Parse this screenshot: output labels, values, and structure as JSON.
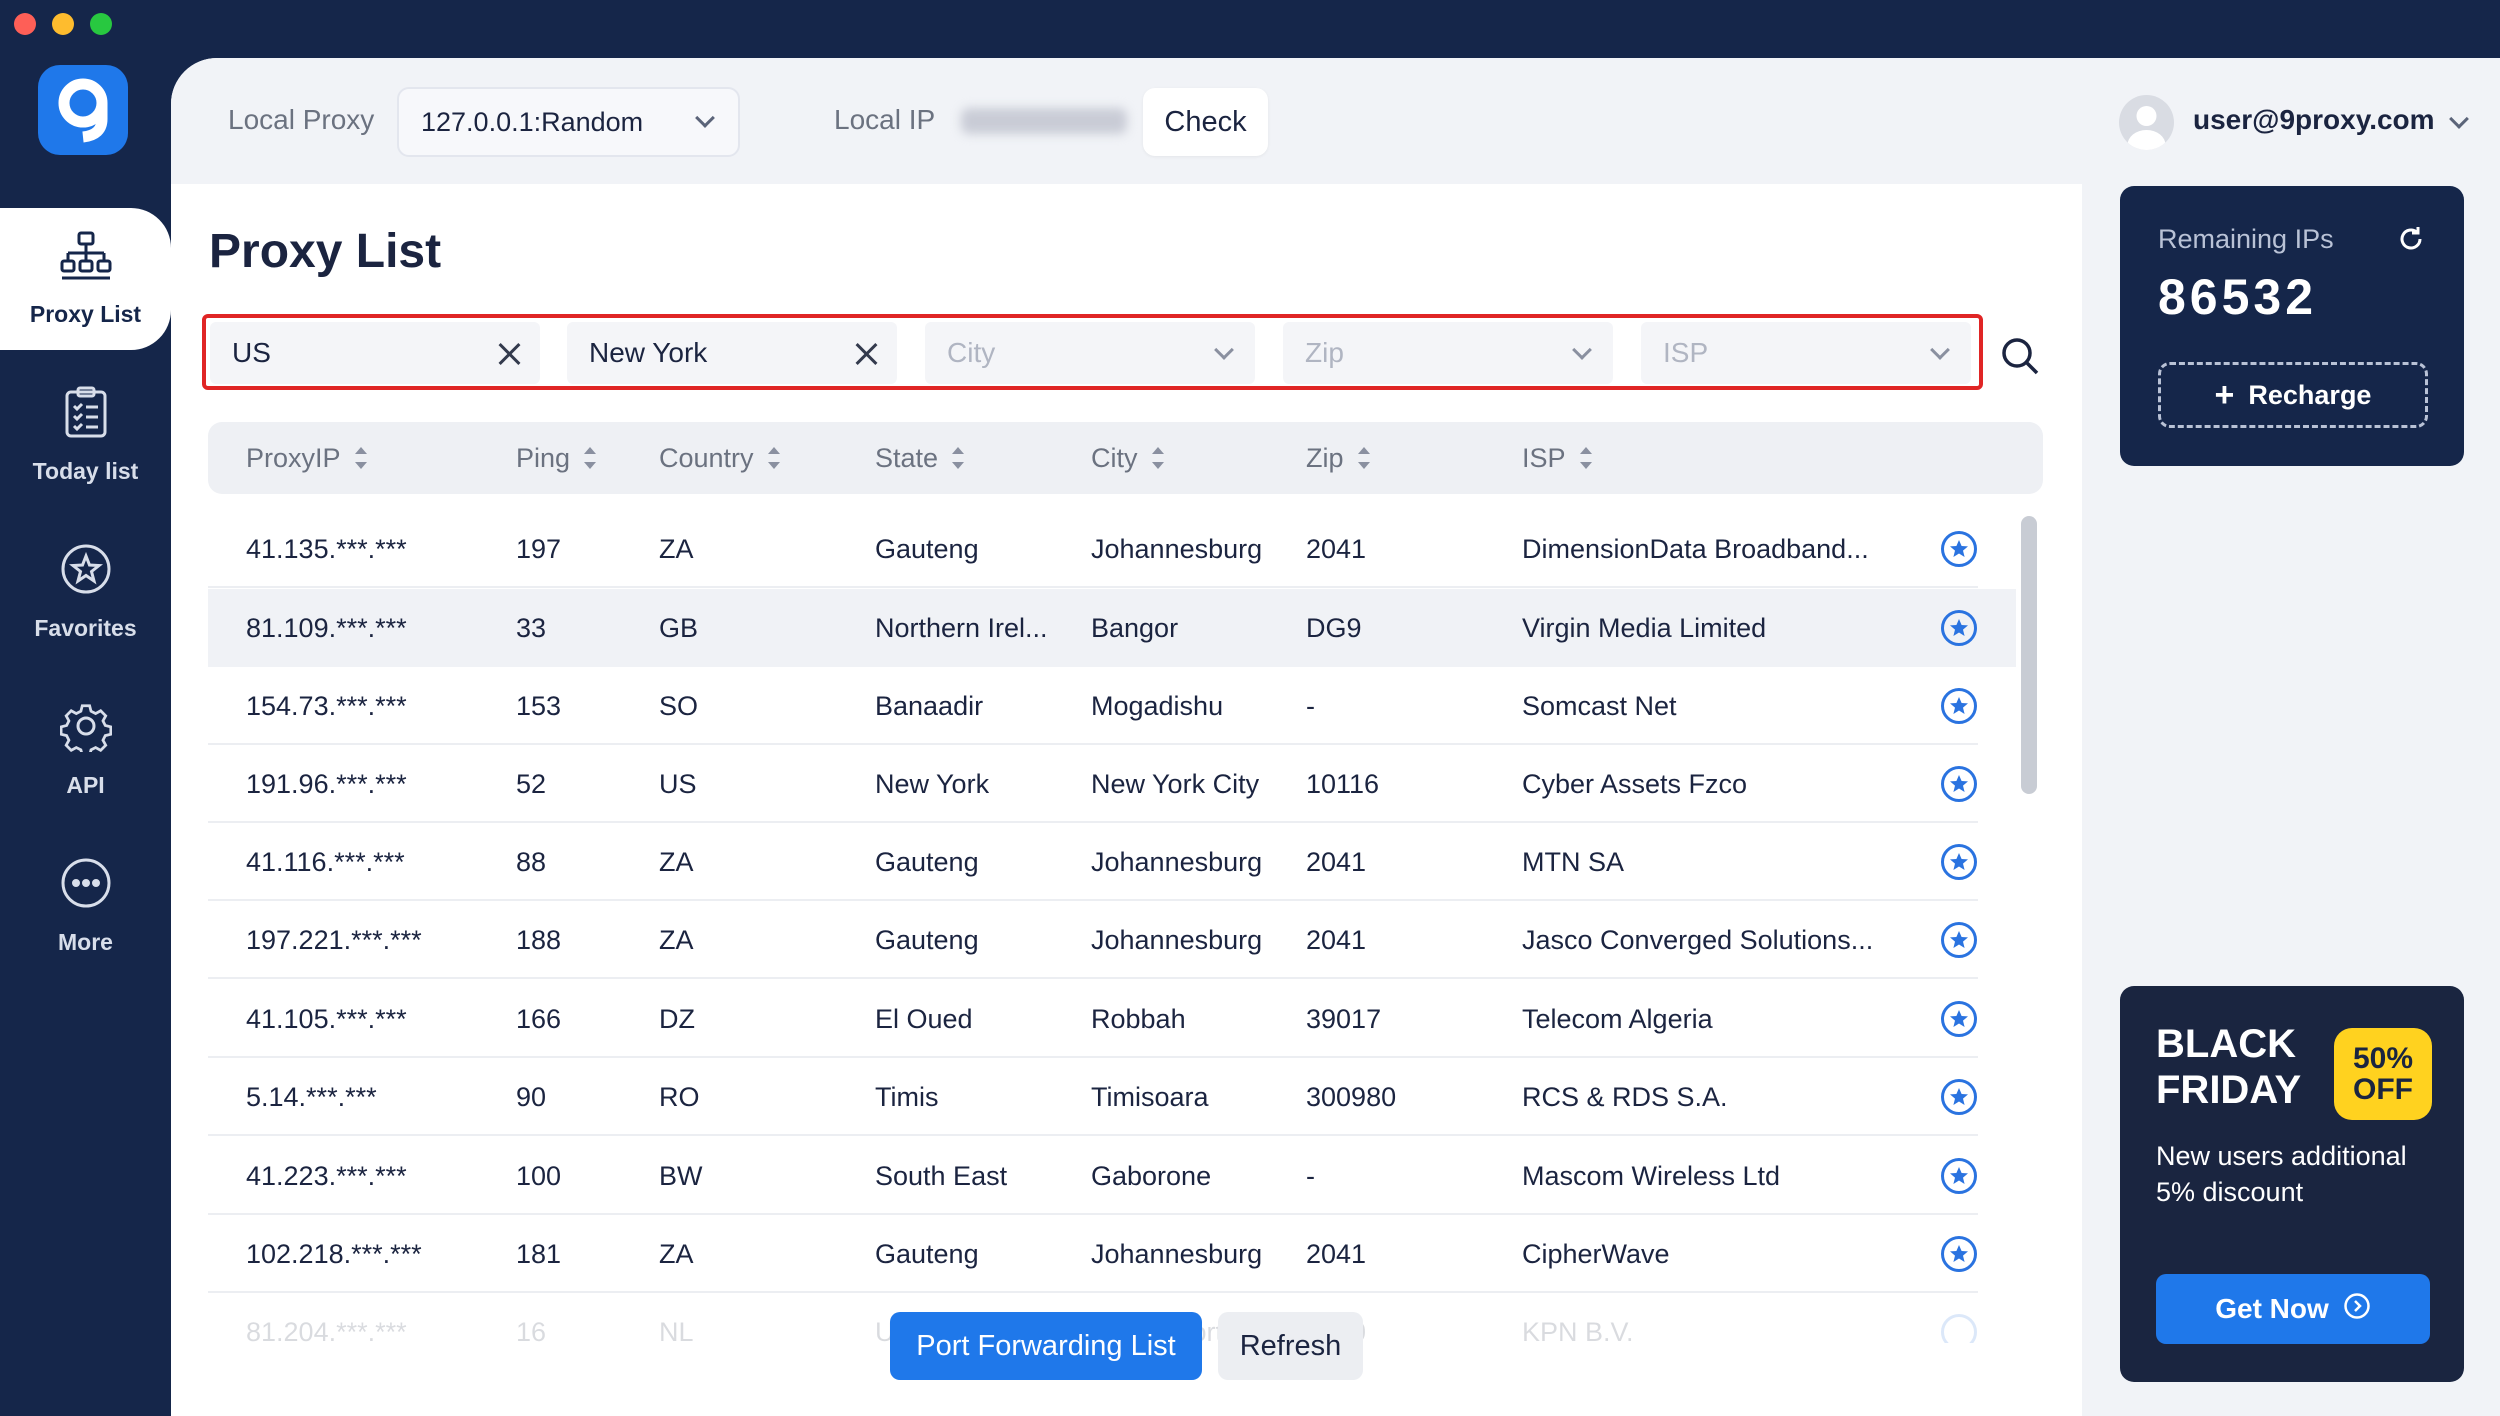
{
  "window": {
    "controls": [
      {
        "name": "close",
        "color": "#fe5f57"
      },
      {
        "name": "minimize",
        "color": "#febc2e"
      },
      {
        "name": "maximize",
        "color": "#28c840"
      }
    ]
  },
  "colors": {
    "sidebar_bg": "#15264a",
    "accent": "#1f78ea",
    "filter_highlight": "#e02525",
    "promo_badge": "#ffd21f"
  },
  "sidebar": {
    "logo_icon": "9proxy-logo",
    "items": [
      {
        "label": "Proxy List",
        "icon": "network-tree-icon",
        "active": true
      },
      {
        "label": "Today list",
        "icon": "checklist-icon",
        "active": false
      },
      {
        "label": "Favorites",
        "icon": "star-circle-icon",
        "active": false
      },
      {
        "label": "API",
        "icon": "gear-icon",
        "active": false
      },
      {
        "label": "More",
        "icon": "more-dots-icon",
        "active": false
      }
    ]
  },
  "topbar": {
    "local_proxy_label": "Local Proxy",
    "local_proxy_value": "127.0.0.1:Random",
    "local_ip_label": "Local IP",
    "check_label": "Check",
    "user_email": "user@9proxy.com"
  },
  "page": {
    "title": "Proxy List"
  },
  "filters": {
    "country": "US",
    "state": "New York",
    "city_placeholder": "City",
    "zip_placeholder": "Zip",
    "isp_placeholder": "ISP"
  },
  "table": {
    "columns": [
      "ProxyIP",
      "Ping",
      "Country",
      "State",
      "City",
      "Zip",
      "ISP"
    ],
    "rows": [
      {
        "ip": "41.135.***.***",
        "ping": "197",
        "country": "ZA",
        "state": "Gauteng",
        "city": "Johannesburg",
        "zip": "2041",
        "isp": "DimensionData Broadband..."
      },
      {
        "ip": "81.109.***.***",
        "ping": "33",
        "country": "GB",
        "state": "Northern Irel...",
        "city": "Bangor",
        "zip": "DG9",
        "isp": "Virgin Media Limited"
      },
      {
        "ip": "154.73.***.***",
        "ping": "153",
        "country": "SO",
        "state": "Banaadir",
        "city": "Mogadishu",
        "zip": "-",
        "isp": "Somcast Net"
      },
      {
        "ip": "191.96.***.***",
        "ping": "52",
        "country": "US",
        "state": "New York",
        "city": "New York City",
        "zip": "10116",
        "isp": "Cyber Assets Fzco"
      },
      {
        "ip": "41.116.***.***",
        "ping": "88",
        "country": "ZA",
        "state": "Gauteng",
        "city": "Johannesburg",
        "zip": "2041",
        "isp": "MTN SA"
      },
      {
        "ip": "197.221.***.***",
        "ping": "188",
        "country": "ZA",
        "state": "Gauteng",
        "city": "Johannesburg",
        "zip": "2041",
        "isp": "Jasco Converged Solutions..."
      },
      {
        "ip": "41.105.***.***",
        "ping": "166",
        "country": "DZ",
        "state": "El Oued",
        "city": "Robbah",
        "zip": "39017",
        "isp": "Telecom Algeria"
      },
      {
        "ip": "5.14.***.***",
        "ping": "90",
        "country": "RO",
        "state": "Timis",
        "city": "Timisoara",
        "zip": "300980",
        "isp": "RCS & RDS S.A."
      },
      {
        "ip": "41.223.***.***",
        "ping": "100",
        "country": "BW",
        "state": "South East",
        "city": "Gaborone",
        "zip": "-",
        "isp": "Mascom Wireless Ltd"
      },
      {
        "ip": "102.218.***.***",
        "ping": "181",
        "country": "ZA",
        "state": "Gauteng",
        "city": "Johannesburg",
        "zip": "2041",
        "isp": "CipherWave"
      },
      {
        "ip": "81.204.***.***",
        "ping": "16",
        "country": "NL",
        "state": "Utrecht",
        "city": "Amersfoort",
        "zip": "3820",
        "isp": "KPN B.V."
      }
    ]
  },
  "actions": {
    "port_forwarding": "Port Forwarding List",
    "refresh": "Refresh"
  },
  "remaining": {
    "label": "Remaining IPs",
    "value": "86532",
    "recharge": "Recharge"
  },
  "promo": {
    "line1": "BLACK",
    "line2": "FRIDAY",
    "badge_top": "50%",
    "badge_bottom": "OFF",
    "text": "New users additional 5% discount",
    "cta": "Get Now"
  }
}
